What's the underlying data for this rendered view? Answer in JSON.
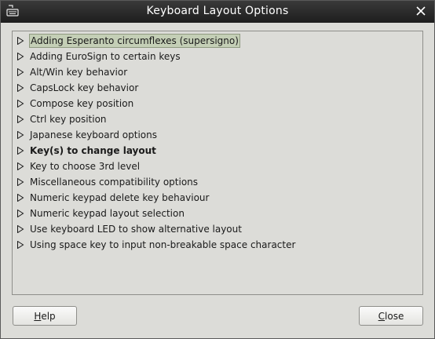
{
  "window": {
    "title": "Keyboard Layout Options",
    "app_icon": "keyboard-icon",
    "close_icon": "close-icon"
  },
  "options": [
    {
      "label": "Adding Esperanto circumflexes (supersigno)",
      "selected": true,
      "bold": false
    },
    {
      "label": "Adding EuroSign to certain keys",
      "selected": false,
      "bold": false
    },
    {
      "label": "Alt/Win key behavior",
      "selected": false,
      "bold": false
    },
    {
      "label": "CapsLock key behavior",
      "selected": false,
      "bold": false
    },
    {
      "label": "Compose key position",
      "selected": false,
      "bold": false
    },
    {
      "label": "Ctrl key position",
      "selected": false,
      "bold": false
    },
    {
      "label": "Japanese keyboard options",
      "selected": false,
      "bold": false
    },
    {
      "label": "Key(s) to change layout",
      "selected": false,
      "bold": true
    },
    {
      "label": "Key to choose 3rd level",
      "selected": false,
      "bold": false
    },
    {
      "label": "Miscellaneous compatibility options",
      "selected": false,
      "bold": false
    },
    {
      "label": "Numeric keypad delete key behaviour",
      "selected": false,
      "bold": false
    },
    {
      "label": "Numeric keypad layout selection",
      "selected": false,
      "bold": false
    },
    {
      "label": "Use keyboard LED to show alternative layout",
      "selected": false,
      "bold": false
    },
    {
      "label": "Using space key to input non-breakable space character",
      "selected": false,
      "bold": false
    }
  ],
  "buttons": {
    "help": {
      "mnemonic": "H",
      "rest": "elp"
    },
    "close": {
      "mnemonic": "C",
      "rest": "lose"
    }
  },
  "colors": {
    "titlebar": "#2a2a2a",
    "selection": "#c4cfb6"
  }
}
